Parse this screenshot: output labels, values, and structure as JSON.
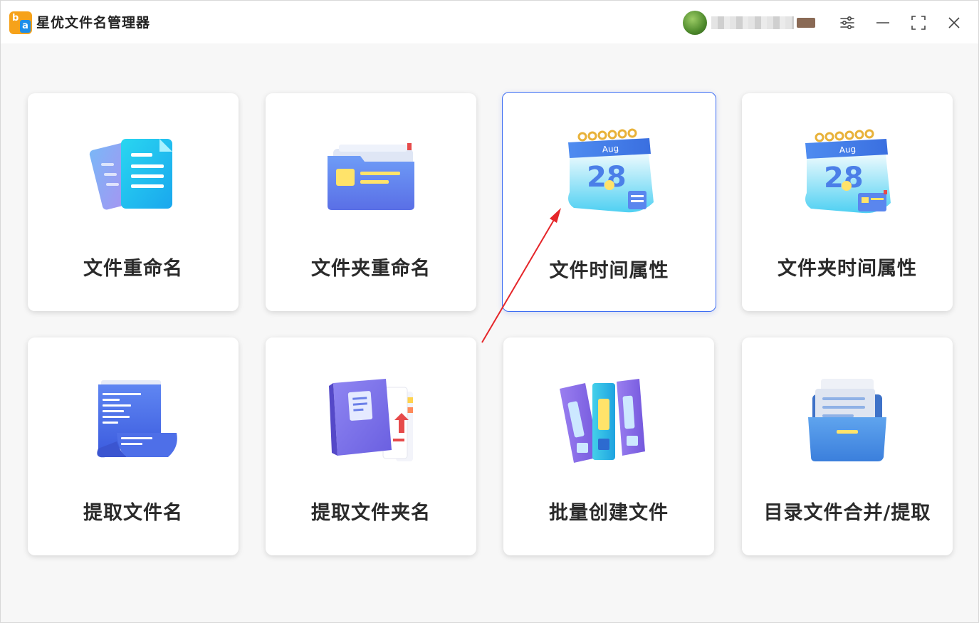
{
  "app": {
    "title": "星优文件名管理器",
    "logo_letter_b": "b",
    "logo_letter_a": "a"
  },
  "user": {
    "name": "......"
  },
  "window_controls": {
    "settings_icon": "sliders-icon",
    "minimize_icon": "minimize-icon",
    "maximize_icon": "maximize-icon",
    "close_icon": "close-icon"
  },
  "cards": [
    {
      "label": "文件重命名",
      "icon": "documents-icon"
    },
    {
      "label": "文件夹重命名",
      "icon": "folder-icon"
    },
    {
      "label": "文件时间属性",
      "icon": "calendar-icon",
      "calendar_month": "Aug",
      "calendar_day": "28"
    },
    {
      "label": "文件夹时间属性",
      "icon": "calendar-folder-icon",
      "calendar_month": "Aug",
      "calendar_day": "28"
    },
    {
      "label": "提取文件名",
      "icon": "scroll-document-icon"
    },
    {
      "label": "提取文件夹名",
      "icon": "folder-extract-icon"
    },
    {
      "label": "批量创建文件",
      "icon": "binders-icon"
    },
    {
      "label": "目录文件合并/提取",
      "icon": "file-cabinet-icon"
    }
  ],
  "colors": {
    "selected_border": "#3d6df2",
    "annotation_arrow": "#e5262a",
    "logo_orange": "#f6a21a",
    "logo_blue": "#1e8de8"
  }
}
